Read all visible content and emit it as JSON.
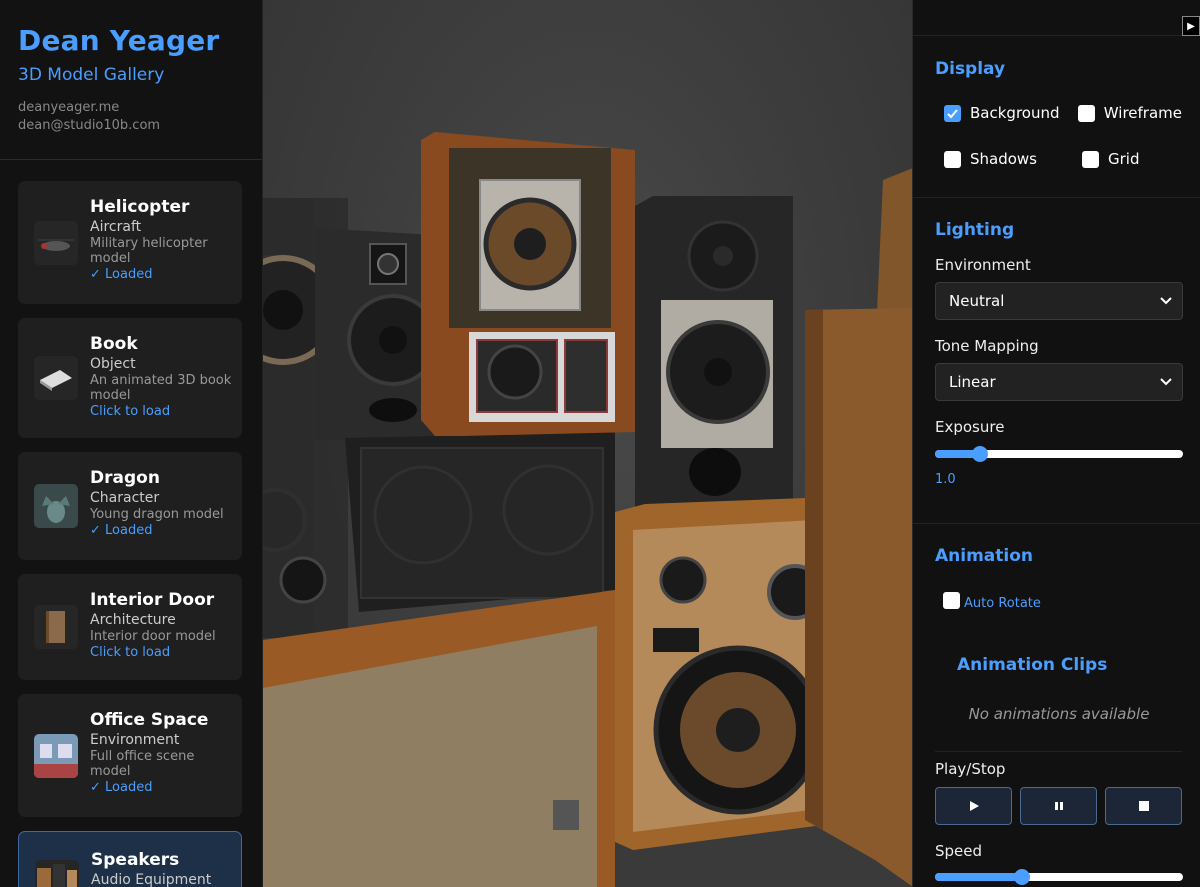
{
  "sidebar": {
    "name": "Dean Yeager",
    "subtitle": "3D Model Gallery",
    "website": "deanyeager.me",
    "email": "dean@studio10b.com",
    "models": [
      {
        "title": "Helicopter",
        "category": "Aircraft",
        "description": "Military helicopter model",
        "status": "✓ Loaded",
        "icon": "helicopter-icon"
      },
      {
        "title": "Book",
        "category": "Object",
        "description": "An animated 3D book model",
        "status": "Click to load",
        "icon": "book-icon"
      },
      {
        "title": "Dragon",
        "category": "Character",
        "description": "Young dragon model",
        "status": "✓ Loaded",
        "icon": "dragon-icon"
      },
      {
        "title": "Interior Door",
        "category": "Architecture",
        "description": "Interior door model",
        "status": "Click to load",
        "icon": "door-icon"
      },
      {
        "title": "Office Space",
        "category": "Environment",
        "description": "Full office scene model",
        "status": "✓ Loaded",
        "icon": "office-icon"
      },
      {
        "title": "Speakers",
        "category": "Audio Equipment",
        "description": "",
        "status": "",
        "icon": "speakers-icon",
        "active": true
      }
    ]
  },
  "panel": {
    "display": {
      "title": "Display",
      "options": [
        {
          "label": "Background",
          "checked": true
        },
        {
          "label": "Wireframe",
          "checked": false
        },
        {
          "label": "Shadows",
          "checked": false
        },
        {
          "label": "Grid",
          "checked": false
        }
      ]
    },
    "lighting": {
      "title": "Lighting",
      "environment_label": "Environment",
      "environment_value": "Neutral",
      "tone_label": "Tone Mapping",
      "tone_value": "Linear",
      "exposure_label": "Exposure",
      "exposure_value": "1.0",
      "exposure_fraction": 0.18
    },
    "animation": {
      "title": "Animation",
      "auto_rotate_label": "Auto Rotate",
      "auto_rotate_checked": false,
      "clips_title": "Animation Clips",
      "clips_empty": "No animations available",
      "play_stop_label": "Play/Stop",
      "buttons": [
        "play",
        "pause",
        "stop"
      ],
      "speed_label": "Speed",
      "speed_fraction": 0.35
    }
  },
  "colors": {
    "accent": "#4a9eff",
    "panel_bg": "#111111",
    "sidebar_bg": "#121212"
  }
}
